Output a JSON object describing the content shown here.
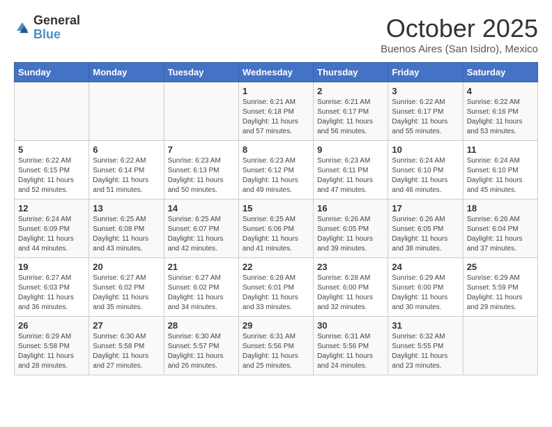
{
  "header": {
    "logo_general": "General",
    "logo_blue": "Blue",
    "title": "October 2025",
    "subtitle": "Buenos Aires (San Isidro), Mexico"
  },
  "days_of_week": [
    "Sunday",
    "Monday",
    "Tuesday",
    "Wednesday",
    "Thursday",
    "Friday",
    "Saturday"
  ],
  "weeks": [
    [
      {
        "day": "",
        "info": ""
      },
      {
        "day": "",
        "info": ""
      },
      {
        "day": "",
        "info": ""
      },
      {
        "day": "1",
        "info": "Sunrise: 6:21 AM\nSunset: 6:18 PM\nDaylight: 11 hours and 57 minutes."
      },
      {
        "day": "2",
        "info": "Sunrise: 6:21 AM\nSunset: 6:17 PM\nDaylight: 11 hours and 56 minutes."
      },
      {
        "day": "3",
        "info": "Sunrise: 6:22 AM\nSunset: 6:17 PM\nDaylight: 11 hours and 55 minutes."
      },
      {
        "day": "4",
        "info": "Sunrise: 6:22 AM\nSunset: 6:16 PM\nDaylight: 11 hours and 53 minutes."
      }
    ],
    [
      {
        "day": "5",
        "info": "Sunrise: 6:22 AM\nSunset: 6:15 PM\nDaylight: 11 hours and 52 minutes."
      },
      {
        "day": "6",
        "info": "Sunrise: 6:22 AM\nSunset: 6:14 PM\nDaylight: 11 hours and 51 minutes."
      },
      {
        "day": "7",
        "info": "Sunrise: 6:23 AM\nSunset: 6:13 PM\nDaylight: 11 hours and 50 minutes."
      },
      {
        "day": "8",
        "info": "Sunrise: 6:23 AM\nSunset: 6:12 PM\nDaylight: 11 hours and 49 minutes."
      },
      {
        "day": "9",
        "info": "Sunrise: 6:23 AM\nSunset: 6:11 PM\nDaylight: 11 hours and 47 minutes."
      },
      {
        "day": "10",
        "info": "Sunrise: 6:24 AM\nSunset: 6:10 PM\nDaylight: 11 hours and 46 minutes."
      },
      {
        "day": "11",
        "info": "Sunrise: 6:24 AM\nSunset: 6:10 PM\nDaylight: 11 hours and 45 minutes."
      }
    ],
    [
      {
        "day": "12",
        "info": "Sunrise: 6:24 AM\nSunset: 6:09 PM\nDaylight: 11 hours and 44 minutes."
      },
      {
        "day": "13",
        "info": "Sunrise: 6:25 AM\nSunset: 6:08 PM\nDaylight: 11 hours and 43 minutes."
      },
      {
        "day": "14",
        "info": "Sunrise: 6:25 AM\nSunset: 6:07 PM\nDaylight: 11 hours and 42 minutes."
      },
      {
        "day": "15",
        "info": "Sunrise: 6:25 AM\nSunset: 6:06 PM\nDaylight: 11 hours and 41 minutes."
      },
      {
        "day": "16",
        "info": "Sunrise: 6:26 AM\nSunset: 6:05 PM\nDaylight: 11 hours and 39 minutes."
      },
      {
        "day": "17",
        "info": "Sunrise: 6:26 AM\nSunset: 6:05 PM\nDaylight: 11 hours and 38 minutes."
      },
      {
        "day": "18",
        "info": "Sunrise: 6:26 AM\nSunset: 6:04 PM\nDaylight: 11 hours and 37 minutes."
      }
    ],
    [
      {
        "day": "19",
        "info": "Sunrise: 6:27 AM\nSunset: 6:03 PM\nDaylight: 11 hours and 36 minutes."
      },
      {
        "day": "20",
        "info": "Sunrise: 6:27 AM\nSunset: 6:02 PM\nDaylight: 11 hours and 35 minutes."
      },
      {
        "day": "21",
        "info": "Sunrise: 6:27 AM\nSunset: 6:02 PM\nDaylight: 11 hours and 34 minutes."
      },
      {
        "day": "22",
        "info": "Sunrise: 6:28 AM\nSunset: 6:01 PM\nDaylight: 11 hours and 33 minutes."
      },
      {
        "day": "23",
        "info": "Sunrise: 6:28 AM\nSunset: 6:00 PM\nDaylight: 11 hours and 32 minutes."
      },
      {
        "day": "24",
        "info": "Sunrise: 6:29 AM\nSunset: 6:00 PM\nDaylight: 11 hours and 30 minutes."
      },
      {
        "day": "25",
        "info": "Sunrise: 6:29 AM\nSunset: 5:59 PM\nDaylight: 11 hours and 29 minutes."
      }
    ],
    [
      {
        "day": "26",
        "info": "Sunrise: 6:29 AM\nSunset: 5:58 PM\nDaylight: 11 hours and 28 minutes."
      },
      {
        "day": "27",
        "info": "Sunrise: 6:30 AM\nSunset: 5:58 PM\nDaylight: 11 hours and 27 minutes."
      },
      {
        "day": "28",
        "info": "Sunrise: 6:30 AM\nSunset: 5:57 PM\nDaylight: 11 hours and 26 minutes."
      },
      {
        "day": "29",
        "info": "Sunrise: 6:31 AM\nSunset: 5:56 PM\nDaylight: 11 hours and 25 minutes."
      },
      {
        "day": "30",
        "info": "Sunrise: 6:31 AM\nSunset: 5:56 PM\nDaylight: 11 hours and 24 minutes."
      },
      {
        "day": "31",
        "info": "Sunrise: 6:32 AM\nSunset: 5:55 PM\nDaylight: 11 hours and 23 minutes."
      },
      {
        "day": "",
        "info": ""
      }
    ]
  ]
}
